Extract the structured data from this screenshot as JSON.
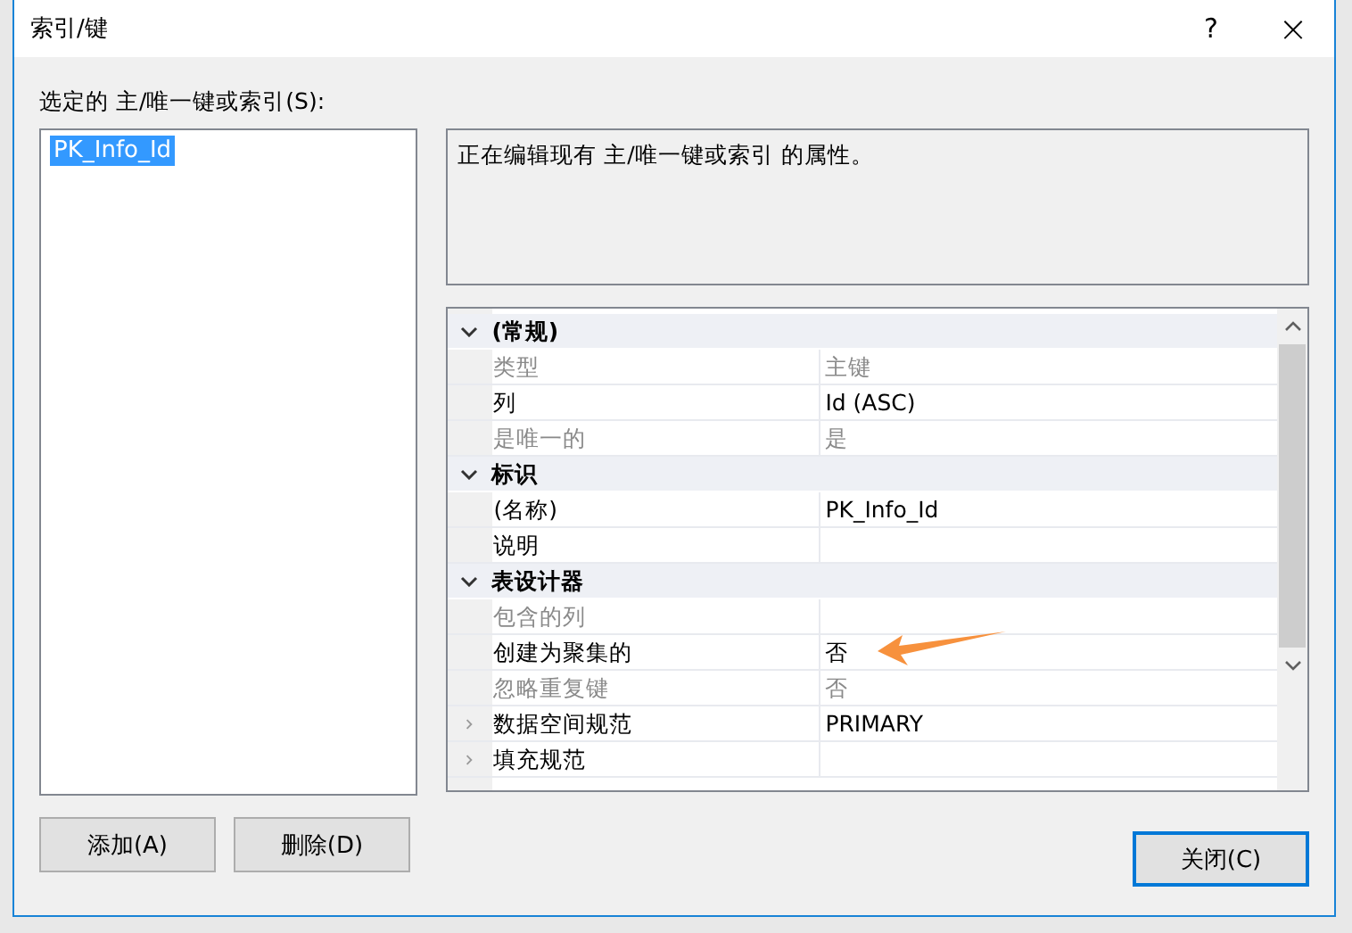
{
  "window": {
    "title": "索引/键",
    "help": "?",
    "close": "×"
  },
  "list_label": "选定的 主/唯一键或索引(S):",
  "keys": [
    {
      "label": "PK_Info_Id",
      "selected": true
    }
  ],
  "description": "正在编辑现有 主/唯一键或索引 的属性。",
  "properties": [
    {
      "kind": "category",
      "name": "(常规)",
      "expanded": true
    },
    {
      "kind": "property",
      "name": "类型",
      "value": "主键",
      "disabled": true
    },
    {
      "kind": "property",
      "name": "列",
      "value": "Id (ASC)",
      "disabled": false
    },
    {
      "kind": "property",
      "name": "是唯一的",
      "value": "是",
      "disabled": true
    },
    {
      "kind": "category",
      "name": "标识",
      "expanded": true
    },
    {
      "kind": "property",
      "name": "(名称)",
      "value": "PK_Info_Id",
      "disabled": false
    },
    {
      "kind": "property",
      "name": "说明",
      "disabled": false
    },
    {
      "kind": "category",
      "name": "表设计器",
      "expanded": true
    },
    {
      "kind": "property",
      "name": "包含的列",
      "disabled": true
    },
    {
      "kind": "property",
      "name": "创建为聚集的",
      "value": "否",
      "disabled": false,
      "highlighted": true
    },
    {
      "kind": "property",
      "name": "忽略重复键",
      "value": "否",
      "disabled": true
    },
    {
      "kind": "property",
      "name": "数据空间规范",
      "value": "PRIMARY",
      "disabled": false,
      "expanded": false
    },
    {
      "kind": "property",
      "name": "填充规范",
      "disabled": false,
      "expanded": false
    }
  ],
  "buttons": [
    {
      "label": "添加(A)"
    },
    {
      "label": "删除(D)"
    }
  ],
  "close_button": {
    "label": "关闭(C)"
  }
}
